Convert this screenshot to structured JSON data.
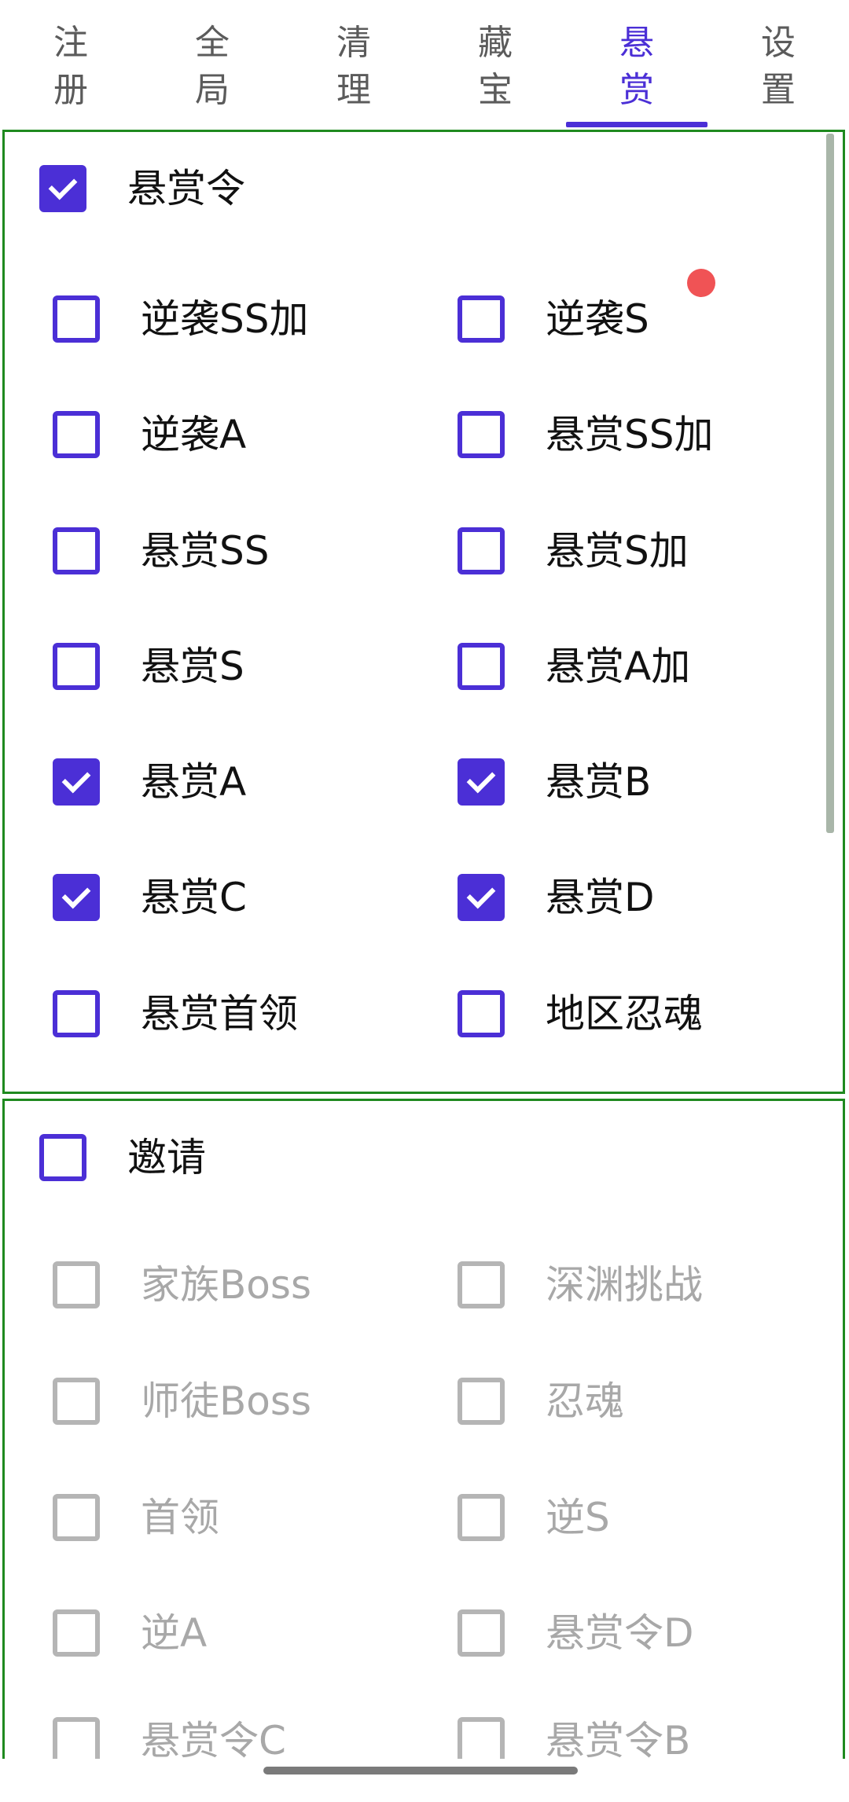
{
  "tabs": [
    {
      "label": "注册",
      "active": false
    },
    {
      "label": "全局",
      "active": false
    },
    {
      "label": "清理",
      "active": false
    },
    {
      "label": "藏宝",
      "active": false
    },
    {
      "label": "悬赏",
      "active": true
    },
    {
      "label": "设置",
      "active": false
    }
  ],
  "bounty": {
    "header": {
      "label": "悬赏令",
      "checked": true
    },
    "items": [
      {
        "label": "逆袭SS加",
        "checked": false
      },
      {
        "label": "逆袭S",
        "checked": false
      },
      {
        "label": "逆袭A",
        "checked": false
      },
      {
        "label": "悬赏SS加",
        "checked": false
      },
      {
        "label": "悬赏SS",
        "checked": false
      },
      {
        "label": "悬赏S加",
        "checked": false
      },
      {
        "label": "悬赏S",
        "checked": false
      },
      {
        "label": "悬赏A加",
        "checked": false
      },
      {
        "label": "悬赏A",
        "checked": true
      },
      {
        "label": "悬赏B",
        "checked": true
      },
      {
        "label": "悬赏C",
        "checked": true
      },
      {
        "label": "悬赏D",
        "checked": true
      },
      {
        "label": "悬赏首领",
        "checked": false
      },
      {
        "label": "地区忍魂",
        "checked": false
      }
    ]
  },
  "invite": {
    "header": {
      "label": "邀请",
      "checked": false
    },
    "items": [
      {
        "label": "家族Boss",
        "checked": false
      },
      {
        "label": "深渊挑战",
        "checked": false
      },
      {
        "label": "师徒Boss",
        "checked": false
      },
      {
        "label": "忍魂",
        "checked": false
      },
      {
        "label": "首领",
        "checked": false
      },
      {
        "label": "逆S",
        "checked": false
      },
      {
        "label": "逆A",
        "checked": false
      },
      {
        "label": "悬赏令D",
        "checked": false
      },
      {
        "label": "悬赏令C",
        "checked": false
      },
      {
        "label": "悬赏令B",
        "checked": false
      }
    ]
  },
  "colors": {
    "accent": "#4b2fd6",
    "panel_border": "#1f8a1f",
    "disabled": "#b5b5b5",
    "notification_dot": "#f05355"
  }
}
